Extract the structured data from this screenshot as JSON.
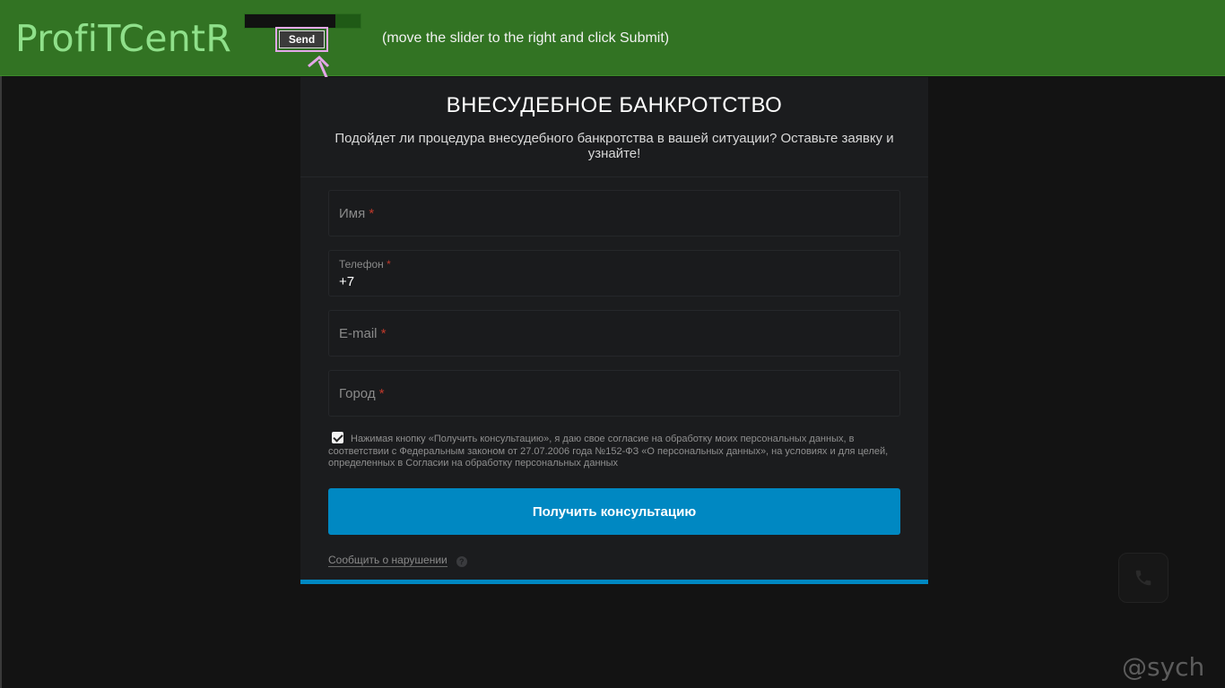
{
  "topbar": {
    "brand": "ProfiTCentR",
    "slider_progress": 0.78,
    "send_label": "Send",
    "hint": "(move the slider to the right and click Submit)"
  },
  "form": {
    "title": "ВНЕСУДЕБНОЕ БАНКРОТСТВО",
    "subtitle": "Подойдет ли процедура внесудебного банкротства в вашей ситуации? Оставьте заявку и узнайте!",
    "fields": [
      {
        "label": "Имя",
        "required_mark": "*",
        "value": ""
      },
      {
        "label": "Телефон",
        "required_mark": "*",
        "value": "+7"
      },
      {
        "label": "E-mail",
        "required_mark": "*",
        "value": ""
      },
      {
        "label": "Город",
        "required_mark": "*",
        "value": ""
      }
    ],
    "consent_checked": true,
    "consent_text": "Нажимая кнопку «Получить консультацию», я даю свое согласие на обработку моих персональных данных, в соответствии с Федеральным законом от 27.07.2006 года №152-ФЗ «О персональных данных», на условиях и для целей, определенных в Согласии на обработку персональных данных",
    "submit_label": "Получить консультацию",
    "report_label": "Сообщить о нарушении",
    "help_glyph": "?"
  },
  "phone_icon": "phone-icon",
  "watermark": "@sych",
  "colors": {
    "topbar": "#327323",
    "accent": "#0088c2",
    "highlight": "#e3a7e8"
  }
}
